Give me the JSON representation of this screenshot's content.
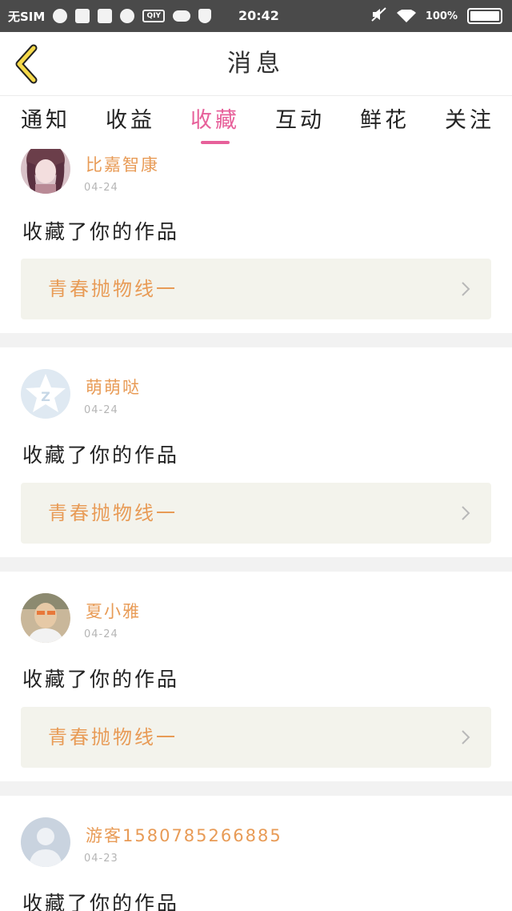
{
  "status_bar": {
    "carrier": "无SIM",
    "time": "20:42",
    "battery": "100"
  },
  "header": {
    "title": "消息"
  },
  "tabs": [
    {
      "label": "通知"
    },
    {
      "label": "收益"
    },
    {
      "label": "收藏"
    },
    {
      "label": "互动"
    },
    {
      "label": "鲜花"
    },
    {
      "label": "关注"
    }
  ],
  "active_tab": "收藏",
  "colors": {
    "accent": "#e7609a",
    "username": "#e89b56",
    "work_box_bg": "#f3f3ec"
  },
  "messages": [
    {
      "user": "比嘉智康",
      "date": "04-24",
      "action": "收藏了你的作品",
      "work": "青春抛物线一",
      "avatar": "anime-girl-avatar"
    },
    {
      "user": "萌萌哒",
      "date": "04-24",
      "action": "收藏了你的作品",
      "work": "青春抛物线一",
      "avatar": "qq-default-avatar"
    },
    {
      "user": "夏小雅",
      "date": "04-24",
      "action": "收藏了你的作品",
      "work": "青春抛物线一",
      "avatar": "photo-avatar"
    },
    {
      "user": "游客1580785266885",
      "date": "04-23",
      "action": "收藏了你的作品",
      "work": "",
      "avatar": "guest-avatar"
    }
  ]
}
